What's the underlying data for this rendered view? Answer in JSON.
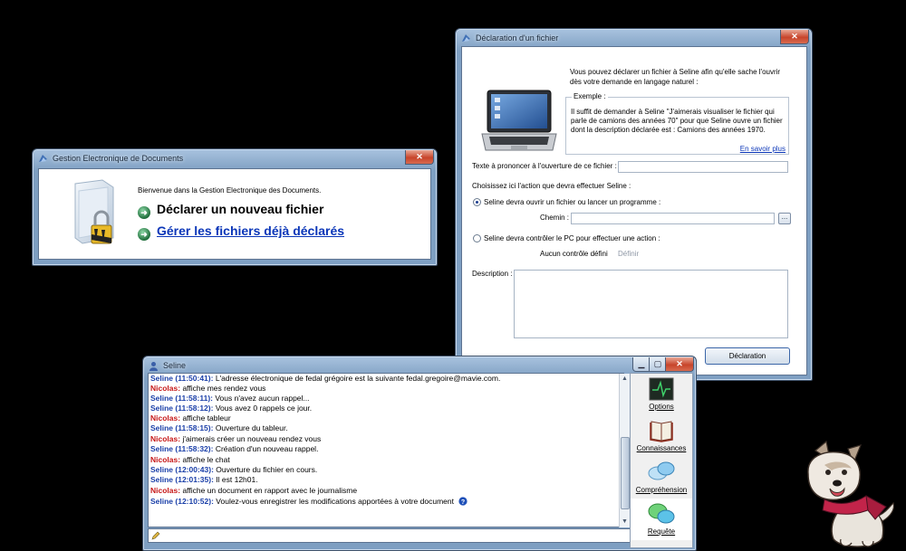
{
  "ged_window": {
    "title": "Gestion Electronique de Documents",
    "welcome": "Bienvenue dans la Gestion Electronique des Documents.",
    "declare_label": "Déclarer un nouveau fichier",
    "manage_label": "Gérer les fichiers déjà déclarés"
  },
  "decl_window": {
    "title": "Déclaration d'un fichier",
    "intro": "Vous pouvez déclarer un fichier à Seline afin qu'elle sache l'ouvrir dès votre demande en langage naturel :",
    "example_legend": "Exemple :",
    "example_text": "Il suffit de demander à Seline \"J'aimerais visualiser le fichier qui parle de camions des années 70\" pour que Seline ouvre un fichier dont la description déclarée est : Camions des années 1970.",
    "learn_more": "En savoir plus",
    "phrase_label": "Texte à prononcer à l'ouverture de ce fichier :",
    "phrase_value": "",
    "choose_action": "Choisissez ici l'action que devra effectuer Seline :",
    "option_open": "Seline devra ouvrir un fichier ou lancer un programme :",
    "path_label": "Chemin :",
    "path_value": "",
    "browse_label": "...",
    "option_control": "Seline devra contrôler le PC pour effectuer une action :",
    "no_control": "Aucun contrôle défini",
    "define_link": "Définir",
    "description_label": "Description :",
    "description_value": "",
    "submit_label": "Déclaration"
  },
  "seline_window": {
    "title": "Seline",
    "messages": [
      {
        "speaker": "Seline (11:50:41):",
        "kind": "seline",
        "text": " L'adresse électronique de fedal grégoire est la suivante fedal.gregoire@mavie.com."
      },
      {
        "speaker": "Nicolas:",
        "kind": "user",
        "text": " affiche mes rendez vous"
      },
      {
        "speaker": "Seline (11:58:11):",
        "kind": "seline",
        "text": " Vous n'avez aucun rappel..."
      },
      {
        "speaker": "Seline (11:58:12):",
        "kind": "seline",
        "text": " Vous avez 0 rappels ce jour."
      },
      {
        "speaker": "Nicolas:",
        "kind": "user",
        "text": " affiche tableur"
      },
      {
        "speaker": "Seline (11:58:15):",
        "kind": "seline",
        "text": " Ouverture du tableur."
      },
      {
        "speaker": "Nicolas:",
        "kind": "user",
        "text": " j'aimerais créer un nouveau rendez vous"
      },
      {
        "speaker": "Seline (11:58:32):",
        "kind": "seline",
        "text": " Création d'un nouveau rappel."
      },
      {
        "speaker": "Nicolas:",
        "kind": "user",
        "text": " affiche le chat"
      },
      {
        "speaker": "Seline (12:00:43):",
        "kind": "seline",
        "text": " Ouverture du fichier en cours."
      },
      {
        "speaker": "Seline (12:01:35):",
        "kind": "seline",
        "text": " Il est 12h01."
      },
      {
        "speaker": "Nicolas:",
        "kind": "user",
        "text": " affiche un document en rapport avec le journalisme"
      },
      {
        "speaker": "Seline (12:10:52):",
        "kind": "seline",
        "text": " Voulez-vous enregistrer les modifications apportées à votre document"
      }
    ],
    "side_buttons": [
      "Options",
      "Connaissances",
      "Compréhension",
      "Requête"
    ],
    "input_value": ""
  },
  "colors": {
    "seline_name": "#1a3fa8",
    "user_name": "#c61717",
    "link": "#0b36b8",
    "desktop": "#000000"
  },
  "icons": [
    "folder-lock-icon",
    "laptop-icon",
    "help-icon",
    "options-icon",
    "book-icon",
    "chat-bubble-icon",
    "request-bubble-icon",
    "dog-mascot"
  ]
}
